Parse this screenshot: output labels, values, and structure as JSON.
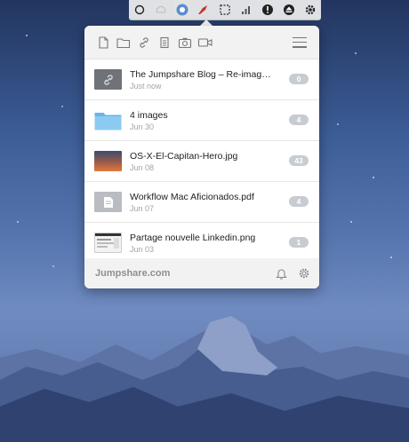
{
  "menubar": {
    "icons": [
      "record-icon",
      "cloud-icon",
      "jumpshare-icon",
      "rocket-icon",
      "screenshot-crop-icon",
      "signal-icon",
      "info-icon",
      "eject-icon",
      "gear-icon"
    ]
  },
  "files": [
    {
      "name": "The Jumpshare Blog – Re-imagining...",
      "date": "Just now",
      "badge": "0",
      "thumb": "link"
    },
    {
      "name": "4 images",
      "date": "Jun 30",
      "badge": "4",
      "thumb": "folder"
    },
    {
      "name": "OS-X-El-Capitan-Hero.jpg",
      "date": "Jun 08",
      "badge": "43",
      "thumb": "photo"
    },
    {
      "name": "Workflow Mac Aficionados.pdf",
      "date": "Jun 07",
      "badge": "4",
      "thumb": "doc"
    },
    {
      "name": "Partage nouvelle Linkedin.png",
      "date": "Jun 03",
      "badge": "1",
      "thumb": "screenshot"
    }
  ],
  "footer": {
    "brand": "Jumpshare.com"
  },
  "colors": {
    "panel_bg": "#ffffff",
    "bar_bg": "#f2f2f2",
    "badge": "#c7ccd3",
    "folder": "#6ab4e8"
  }
}
